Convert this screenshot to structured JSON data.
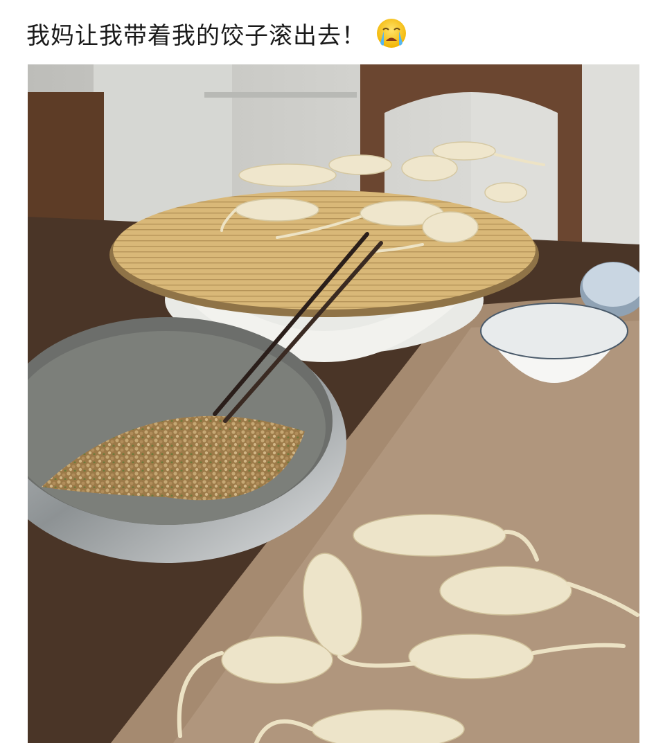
{
  "post": {
    "caption": "我妈让我带着我的饺子滚出去！",
    "emoji_icon": "crying-face-icon"
  },
  "photo": {
    "description_icons": [
      "rat-shaped-dumpling",
      "chopsticks",
      "filling-bowl"
    ],
    "colors": {
      "wall": "#dcdcd8",
      "table": "#8a6d55",
      "board": "#b79f86",
      "dough": "#eae1c6",
      "mat": "#d8b67b",
      "basin_flower": "#c0283c"
    }
  }
}
